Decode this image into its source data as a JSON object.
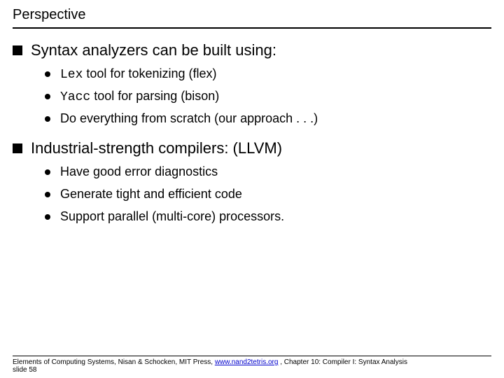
{
  "title": "Perspective",
  "bullets": [
    {
      "text": "Syntax analyzers can be built using:",
      "sub": [
        {
          "mono": "Lex",
          "rest": " tool for tokenizing (flex)"
        },
        {
          "mono": "Yacc",
          "rest": " tool for parsing (bison)"
        },
        {
          "mono": "",
          "rest": "Do everything from scratch (our approach . . .)"
        }
      ]
    },
    {
      "text": "Industrial-strength compilers: (LLVM)",
      "sub": [
        {
          "mono": "",
          "rest": "Have good error diagnostics"
        },
        {
          "mono": "",
          "rest": "Generate tight and efficient code"
        },
        {
          "mono": "",
          "rest": "Support parallel (multi-core) processors."
        }
      ]
    }
  ],
  "footer": {
    "prefix": "Elements of Computing Systems, Nisan & Schocken, MIT Press, ",
    "link": "www.nand2tetris.org",
    "suffix": " , Chapter 10: Compiler I: Syntax Analysis",
    "slide": "slide 58"
  }
}
